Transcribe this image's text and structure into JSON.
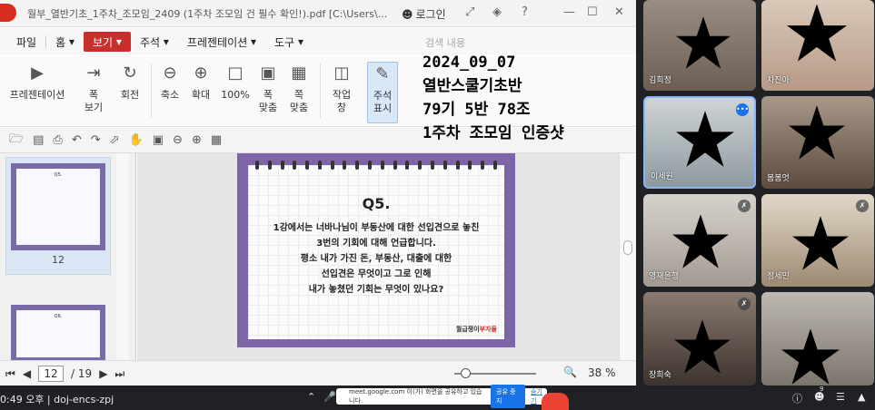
{
  "window": {
    "title": "월부_열반기초_1주차_조모임_2409 (1주차 조모임 건 필수 확인!).pdf [C:\\Users\\...",
    "login_label": "로그인"
  },
  "menu": {
    "items": [
      "파일",
      "홈",
      "보기",
      "주석",
      "프레젠테이션",
      "도구"
    ],
    "active": "보기",
    "search_placeholder": "검색 내용"
  },
  "ribbon": {
    "presentation": "프레젠테이션",
    "width": "폭\n보기",
    "rotate": "회전",
    "zoom_out": "축소",
    "zoom_in": "확대",
    "actual": "100%",
    "fit_width": "폭\n맞춤",
    "fit_page": "쪽\n맞춤",
    "task": "작업\n창",
    "annot": "주석\n표시"
  },
  "overlay": {
    "lines": [
      "2024_09_07",
      "열반스쿨기초반",
      "79기 5반 78조",
      "1주차 조모임 인증샷"
    ]
  },
  "thumbnails": [
    {
      "page_number": "12",
      "title": "Q5.",
      "selected": true
    },
    {
      "page_number": "",
      "title": "Q6.",
      "selected": false
    }
  ],
  "slide": {
    "title": "Q5.",
    "body": "1강에서는 너바나님이 부동산에 대한 선입견으로 놓친\n3번의 기회에 대해 언급합니다.\n평소 내가 가진 돈, 부동산, 대출에 대한\n선입견은 무엇이고 그로 인해\n내가 놓쳤던 기회는 무엇이 있나요?",
    "brand_prefix": "월급쟁이",
    "brand_suffix": "부자들"
  },
  "status": {
    "current_page": "12",
    "total_pages": "/ 19",
    "zoom": "38 %"
  },
  "participants": [
    {
      "name": "김희정",
      "muted": false
    },
    {
      "name": "차진아",
      "muted": false
    },
    {
      "name": "이세원",
      "muted": false,
      "speaking": true
    },
    {
      "name": "봄봄엇",
      "muted": false
    },
    {
      "name": "영재윤행",
      "muted": true
    },
    {
      "name": "정세민",
      "muted": true
    },
    {
      "name": "장희숙",
      "muted": true
    },
    {
      "name": "",
      "muted": false
    }
  ],
  "meet": {
    "time_code": "0:49 오후  |  doj-encs-zpj",
    "share_message": "meet.google.com 이(가) 화면을 공유하고 있습니다.",
    "stop_label": "공유 중지",
    "hide_label": "숨기기",
    "participant_count": "9"
  }
}
